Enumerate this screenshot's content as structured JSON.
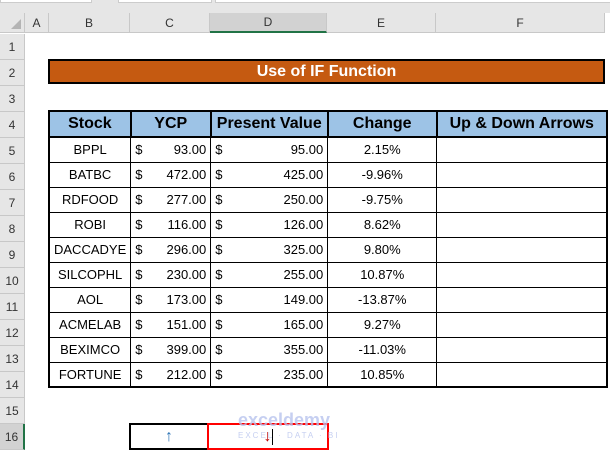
{
  "columns": [
    "A",
    "B",
    "C",
    "D",
    "E",
    "F"
  ],
  "rows": [
    "1",
    "2",
    "3",
    "4",
    "5",
    "6",
    "7",
    "8",
    "9",
    "10",
    "11",
    "12",
    "13",
    "14",
    "15",
    "16"
  ],
  "title": "Use of IF Function",
  "table": {
    "headers": [
      "Stock",
      "YCP",
      "Present Value",
      "Change",
      "Up & Down Arrows"
    ],
    "rows": [
      [
        "BPPL",
        "$",
        "93.00",
        "$",
        "95.00",
        "2.15%",
        ""
      ],
      [
        "BATBC",
        "$",
        "472.00",
        "$",
        "425.00",
        "-9.96%",
        ""
      ],
      [
        "RDFOOD",
        "$",
        "277.00",
        "$",
        "250.00",
        "-9.75%",
        ""
      ],
      [
        "ROBI",
        "$",
        "116.00",
        "$",
        "126.00",
        "8.62%",
        ""
      ],
      [
        "DACCADYE",
        "$",
        "296.00",
        "$",
        "325.00",
        "9.80%",
        ""
      ],
      [
        "SILCOPHL",
        "$",
        "230.00",
        "$",
        "255.00",
        "10.87%",
        ""
      ],
      [
        "AOL",
        "$",
        "173.00",
        "$",
        "149.00",
        "-13.87%",
        ""
      ],
      [
        "ACMELAB",
        "$",
        "151.00",
        "$",
        "165.00",
        "9.27%",
        ""
      ],
      [
        "BEXIMCO",
        "$",
        "399.00",
        "$",
        "355.00",
        "-11.03%",
        ""
      ],
      [
        "FORTUNE",
        "$",
        "212.00",
        "$",
        "235.00",
        "10.85%",
        ""
      ]
    ]
  },
  "arrows": {
    "up": "↑",
    "down": "↓",
    "up_color": "#2e75b6",
    "down_color": "#c00000"
  },
  "watermark": {
    "name": "exceldemy",
    "tagline": "EXCEL · DATA · BI"
  },
  "colors": {
    "title_bg": "#c55a11",
    "header_bg": "#9dc3e6",
    "selection": "#ff0000"
  }
}
